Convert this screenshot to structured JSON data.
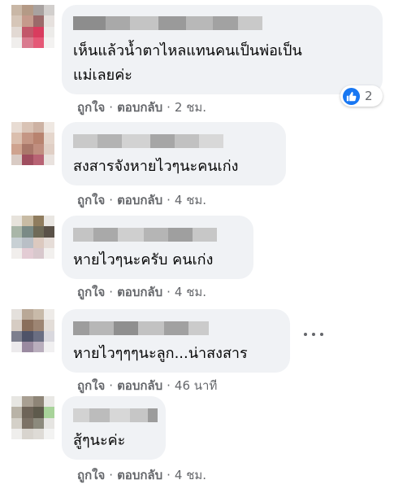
{
  "comments": [
    {
      "text_lines": [
        "เห็นแล้วน้ำตาไหลแทนคนเป็นพ่อเป็น",
        "แม่เลยค่ะ"
      ],
      "actions": {
        "like": "ถูกใจ",
        "reply": "ตอบกลับ",
        "time": "2 ชม."
      },
      "reaction": {
        "icon": "thumbs-up-icon",
        "count": "2"
      }
    },
    {
      "text_lines": [
        "สงสารจังหายไวๆนะคนเก่ง"
      ],
      "actions": {
        "like": "ถูกใจ",
        "reply": "ตอบกลับ",
        "time": "4 ชม."
      }
    },
    {
      "text_lines": [
        "หายไวๆนะครับ คนเก่ง"
      ],
      "actions": {
        "like": "ถูกใจ",
        "reply": "ตอบกลับ",
        "time": "4 ชม."
      }
    },
    {
      "text_lines": [
        "หายไวๆๆๆนะลูก...น่าสงสาร"
      ],
      "actions": {
        "like": "ถูกใจ",
        "reply": "ตอบกลับ",
        "time": "46 นาที"
      },
      "more_icon": "more-options-icon"
    },
    {
      "text_lines": [
        "สู้ๆนะค่ะ"
      ],
      "actions": {
        "like": "ถูกใจ",
        "reply": "ตอบกลับ",
        "time": "4 ชม."
      }
    }
  ],
  "separator": "·",
  "colors": {
    "bubble": "#f0f2f5",
    "text": "#050505",
    "meta": "#65676b",
    "like_blue": "#1877f2"
  }
}
